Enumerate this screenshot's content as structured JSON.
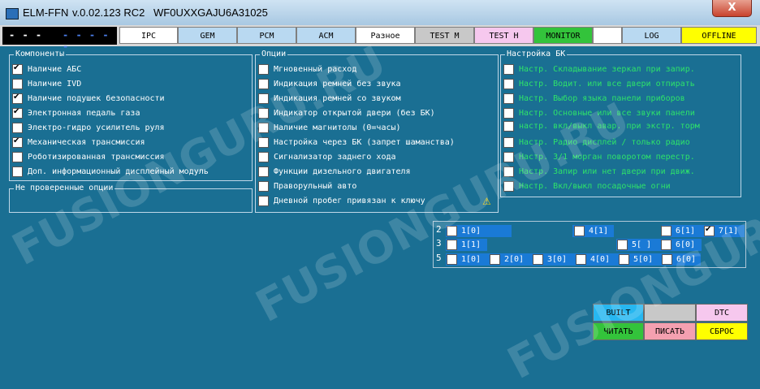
{
  "window": {
    "title": "ELM-FFN",
    "version": "v.0.02.123 RC2",
    "vin": "WF0UXXGAJU6A31025",
    "close_label": "X"
  },
  "toolbar": {
    "indicator": {
      "left": "- - -",
      "right": "- - - - -"
    },
    "tabs": [
      {
        "label": "IPC",
        "color": "#ffffff"
      },
      {
        "label": "GEM",
        "color": "#b9d9f1"
      },
      {
        "label": "PCM",
        "color": "#b9d9f1"
      },
      {
        "label": "ACM",
        "color": "#b9d9f1"
      },
      {
        "label": "Разное",
        "color": "#ffffff"
      },
      {
        "label": "TEST M",
        "color": "#c8c8c8"
      },
      {
        "label": "TEST H",
        "color": "#f6c8ee"
      },
      {
        "label": "MONITOR",
        "color": "#33c33b"
      },
      {
        "label": "",
        "color": "#ffffff"
      },
      {
        "label": "LOG",
        "color": "#b9d9f1"
      },
      {
        "label": "OFFLINE",
        "color": "#ffff00"
      }
    ]
  },
  "components": {
    "legend": "Компоненты",
    "items": [
      {
        "label": "Наличие АБС",
        "checked": true
      },
      {
        "label": "Наличие IVD",
        "checked": false
      },
      {
        "label": "Наличие подушек безопасности",
        "checked": true
      },
      {
        "label": "Электронная педаль газа",
        "checked": true
      },
      {
        "label": "Электро-гидро усилитель руля",
        "checked": false
      },
      {
        "label": "Механическая трансмиссия",
        "checked": true
      },
      {
        "label": "Роботизированная трансмиссия",
        "checked": false
      },
      {
        "label": "Доп. информационный дисплейный модуль",
        "checked": false
      }
    ]
  },
  "unchecked_options": {
    "legend": "Не проверенные опции"
  },
  "options": {
    "legend": "Опции",
    "items": [
      {
        "label": "Мгновенный расход",
        "checked": false
      },
      {
        "label": "Индикация ремней без звука",
        "checked": false
      },
      {
        "label": "Индикация ремней со звуком",
        "checked": false
      },
      {
        "label": "Индикатор открытой двери (без БК)",
        "checked": false
      },
      {
        "label": "Наличие магнитолы (0=часы)",
        "checked": false
      },
      {
        "label": "Настройка через БК (запрет шаманства)",
        "checked": false
      },
      {
        "label": "Сигнализатор заднего хода",
        "checked": false
      },
      {
        "label": "Функции дизельного двигателя",
        "checked": false
      },
      {
        "label": "Праворульный авто",
        "checked": false
      },
      {
        "label": "Дневной пробег привязан к ключу",
        "checked": false,
        "warning": true
      }
    ]
  },
  "bk_settings": {
    "legend": "Настройка БК",
    "items": [
      {
        "label": "Настр. Складывание зеркал при запир.",
        "checked": false
      },
      {
        "label": "Настр. Водит. или все двери отпирать",
        "checked": false
      },
      {
        "label": "Настр. Выбор языка панели приборов",
        "checked": false
      },
      {
        "label": "Настр. Основные или все звуки панели",
        "checked": false
      },
      {
        "label": "настр. вкл/выкл авар. при экстр. торм",
        "checked": false
      },
      {
        "label": "Настр. Радио дисплей / только радио",
        "checked": false
      },
      {
        "label": "Настр. 3/1 морган поворотом перестр.",
        "checked": false
      },
      {
        "label": "Настр. Запир или нет двери при движ.",
        "checked": false
      },
      {
        "label": "Настр. Вкл/выкл посадочные огни",
        "checked": false
      }
    ]
  },
  "matrix": {
    "rows": [
      {
        "num": "2",
        "cells": [
          {
            "label": "1[0]",
            "checked": false
          },
          {
            "label": "4[1]",
            "checked": false
          },
          {
            "label": "6[1]",
            "checked": false
          },
          {
            "label": "7[1]",
            "checked": true
          }
        ]
      },
      {
        "num": "3",
        "cells": [
          {
            "label": "1[1]",
            "checked": false
          },
          {
            "label": "5[ ]",
            "checked": false
          },
          {
            "label": "6[0]",
            "checked": false
          }
        ]
      },
      {
        "num": "5",
        "cells": [
          {
            "label": "1[0]",
            "checked": false
          },
          {
            "label": "2[0]",
            "checked": false
          },
          {
            "label": "3[0]",
            "checked": false
          },
          {
            "label": "4[0]",
            "checked": false
          },
          {
            "label": "5[0]",
            "checked": false
          },
          {
            "label": "6[0]",
            "checked": false
          }
        ]
      }
    ]
  },
  "actions": {
    "built": "BUILT",
    "blank": "",
    "dtc": "DTC",
    "read": "ЧИТАТЬ",
    "write": "ПИСАТЬ",
    "reset": "СБРОС"
  },
  "watermark": "FUSIONGURU.RU"
}
